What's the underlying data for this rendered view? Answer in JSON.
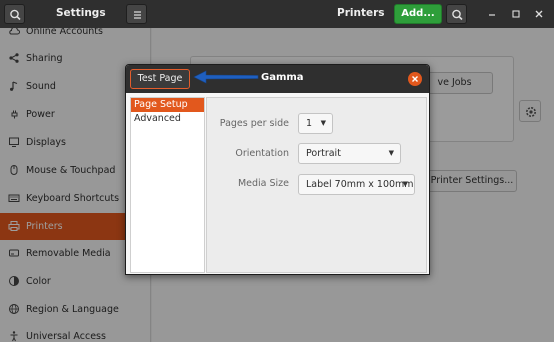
{
  "headerbar": {
    "settings_title": "Settings",
    "printers_title": "Printers",
    "add_label": "Add..."
  },
  "sidebar": {
    "items": [
      {
        "label": "Online Accounts",
        "icon": "cloud-icon"
      },
      {
        "label": "Sharing",
        "icon": "share-icon"
      },
      {
        "label": "Sound",
        "icon": "music-note-icon"
      },
      {
        "label": "Power",
        "icon": "power-icon"
      },
      {
        "label": "Displays",
        "icon": "display-icon"
      },
      {
        "label": "Mouse & Touchpad",
        "icon": "mouse-icon"
      },
      {
        "label": "Keyboard Shortcuts",
        "icon": "keyboard-icon"
      },
      {
        "label": "Printers",
        "icon": "printer-icon",
        "active": true
      },
      {
        "label": "Removable Media",
        "icon": "removable-media-icon"
      },
      {
        "label": "Color",
        "icon": "color-icon"
      },
      {
        "label": "Region & Language",
        "icon": "globe-icon"
      },
      {
        "label": "Universal Access",
        "icon": "accessibility-icon"
      }
    ]
  },
  "main": {
    "jobs_button_partial": "ve Jobs",
    "printer_settings_partial": "Printer Settings..."
  },
  "dialog": {
    "test_page_label": "Test Page",
    "title": "Gamma",
    "nav": {
      "page_setup": "Page Setup",
      "advanced": "Advanced"
    },
    "fields": {
      "pages_per_side_label": "Pages per side",
      "pages_per_side_value": "1",
      "orientation_label": "Orientation",
      "orientation_value": "Portrait",
      "media_size_label": "Media Size",
      "media_size_value": "Label 70mm x 100mm"
    }
  },
  "colors": {
    "accent": "#e2581d",
    "add_button": "#2e9e3a",
    "annotation_arrow": "#1f5fbf"
  }
}
